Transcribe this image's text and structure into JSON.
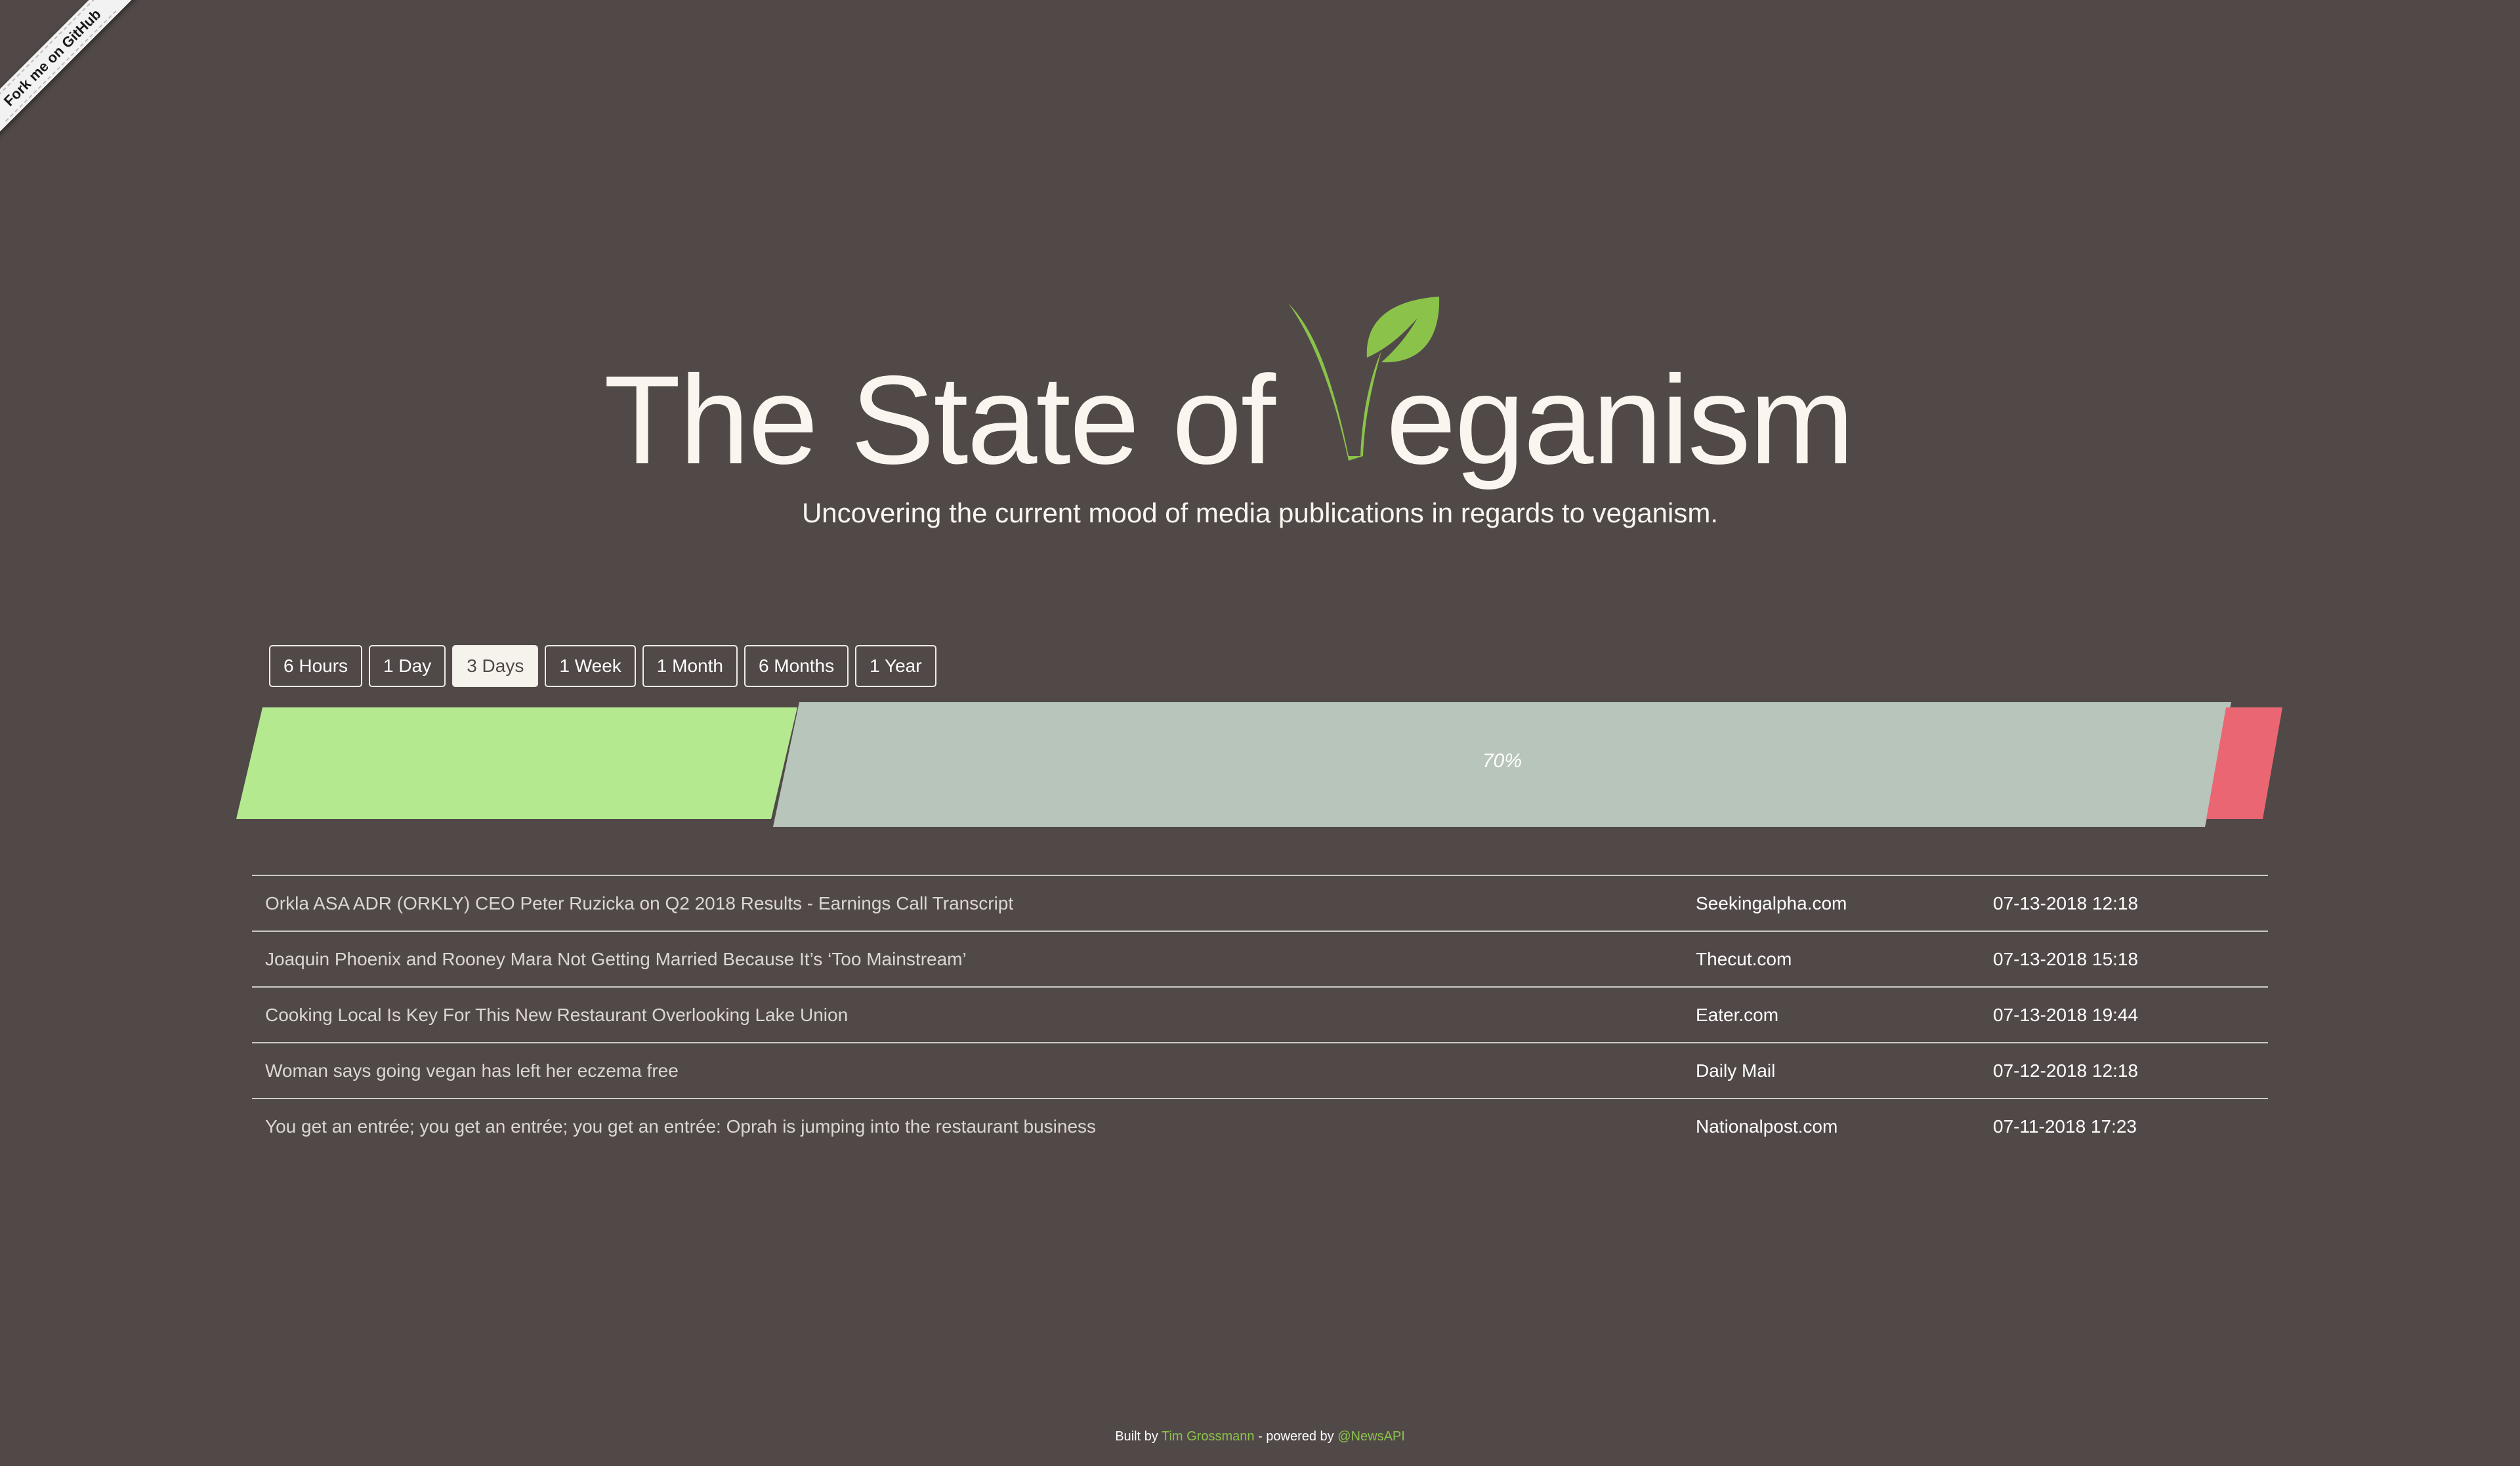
{
  "ribbon": {
    "label": "Fork me on GitHub"
  },
  "header": {
    "title_left": "The State of",
    "title_right": "eganism",
    "subtitle": "Uncovering the current mood of media publications in regards to veganism."
  },
  "ranges": [
    {
      "label": "6 Hours",
      "active": false
    },
    {
      "label": "1 Day",
      "active": false
    },
    {
      "label": "3 Days",
      "active": true
    },
    {
      "label": "1 Week",
      "active": false
    },
    {
      "label": "1 Month",
      "active": false
    },
    {
      "label": "6 Months",
      "active": false
    },
    {
      "label": "1 Year",
      "active": false
    }
  ],
  "sentiment": {
    "neutral_label": "70%",
    "colors": {
      "positive": "#b4e990",
      "neutral": "#b8c5bb",
      "negative": "#ea6673"
    }
  },
  "articles": [
    {
      "headline": "Orkla ASA ADR (ORKLY) CEO Peter Ruzicka on Q2 2018 Results - Earnings Call Transcript",
      "source": "Seekingalpha.com",
      "date": "07-13-2018 12:18"
    },
    {
      "headline": "Joaquin Phoenix and Rooney Mara Not Getting Married Because It’s ‘Too Mainstream’",
      "source": "Thecut.com",
      "date": "07-13-2018 15:18"
    },
    {
      "headline": "Cooking Local Is Key For This New Restaurant Overlooking Lake Union",
      "source": "Eater.com",
      "date": "07-13-2018 19:44"
    },
    {
      "headline": "Woman says going vegan has left her eczema free",
      "source": "Daily Mail",
      "date": "07-12-2018 12:18"
    },
    {
      "headline": "You get an entrée; you get an entrée; you get an entrée: Oprah is jumping into the restaurant business",
      "source": "Nationalpost.com",
      "date": "07-11-2018 17:23"
    }
  ],
  "footer": {
    "built_by": "Built by",
    "author": "Tim Grossmann",
    "separator": "- powered by",
    "powered_by": "@NewsAPI"
  },
  "colors": {
    "background": "#514948",
    "accent_green": "#8bc34a",
    "title_text": "#faf5ee"
  }
}
